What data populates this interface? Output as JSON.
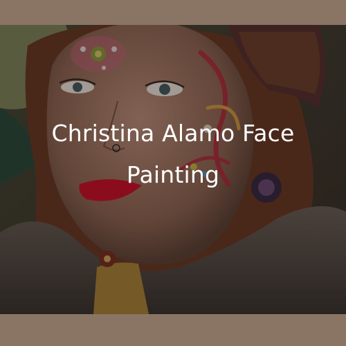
{
  "caption": {
    "line1": "Christina Alamo Face",
    "line2": "Painting"
  },
  "colors": {
    "frame": "#8a7565",
    "caption_text": "#ffffff"
  }
}
